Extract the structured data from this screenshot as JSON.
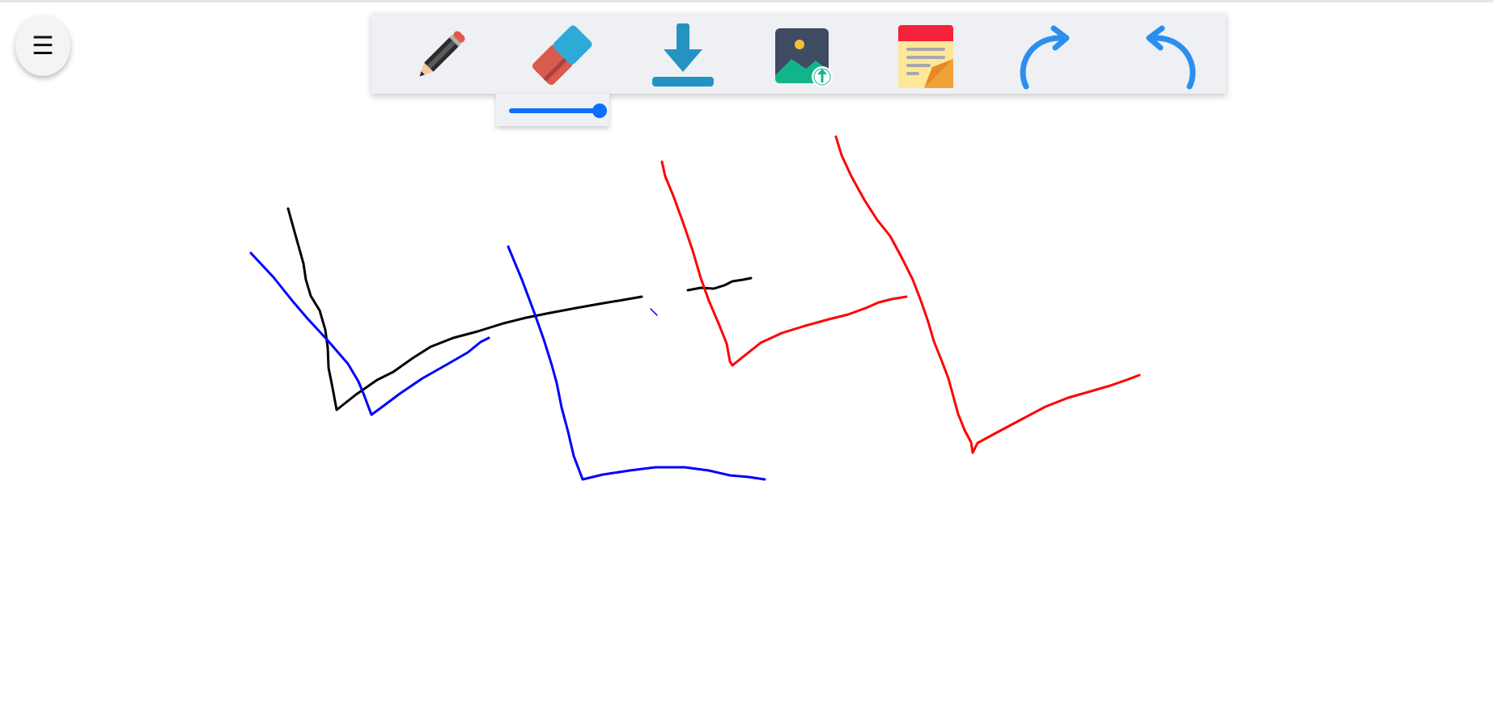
{
  "menu": {
    "icon": "hamburger-menu-icon",
    "glyph": "☰"
  },
  "toolbar": {
    "tools": [
      {
        "name": "pencil",
        "icon": "pencil-icon"
      },
      {
        "name": "eraser",
        "icon": "eraser-icon"
      },
      {
        "name": "download",
        "icon": "download-icon"
      },
      {
        "name": "upload-image",
        "icon": "image-upload-icon"
      },
      {
        "name": "sticky-note",
        "icon": "sticky-note-icon"
      },
      {
        "name": "redo",
        "icon": "redo-arrow-icon"
      },
      {
        "name": "undo",
        "icon": "undo-arrow-icon"
      }
    ]
  },
  "brush_size": {
    "fraction": 1.0,
    "color": "#0d6efd"
  },
  "drawing_colors": {
    "black": "#000000",
    "blue": "#0000ff",
    "red": "#ff0000"
  }
}
